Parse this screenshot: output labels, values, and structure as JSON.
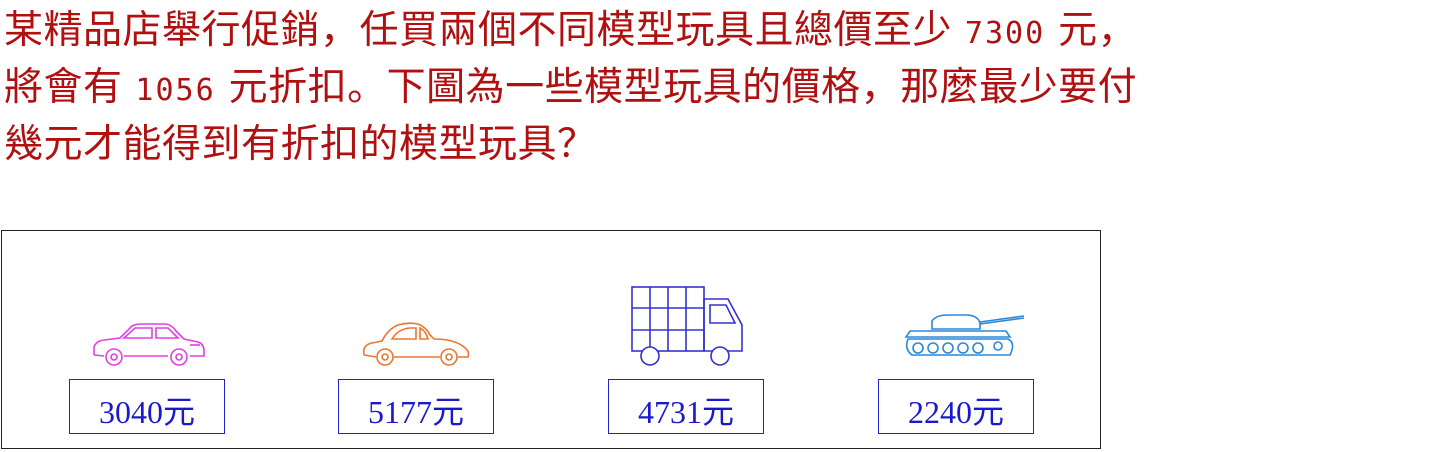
{
  "question": {
    "line1_a": "某精品店舉行促銷，任買兩個不同模型玩具且總價至少",
    "line1_num": "7300",
    "line1_b": "元，",
    "line2_a": "將會有",
    "line2_num": "1056",
    "line2_b": "元折扣。下圖為一些模型玩具的價格，那麼最少要付",
    "line3": "幾元才能得到有折扣的模型玩具？"
  },
  "toys": [
    {
      "name": "car",
      "icon": "car-icon",
      "color": "#e040e0",
      "price": "3040元"
    },
    {
      "name": "vintage-car",
      "icon": "vintage-car-icon",
      "color": "#e87830",
      "price": "5177元"
    },
    {
      "name": "truck",
      "icon": "truck-icon",
      "color": "#3333cc",
      "price": "4731元"
    },
    {
      "name": "tank",
      "icon": "tank-icon",
      "color": "#2a88d8",
      "price": "2240元"
    }
  ],
  "colors": {
    "question_text": "#b01010",
    "price_text": "#1a1acc",
    "panel_border": "#222222"
  }
}
